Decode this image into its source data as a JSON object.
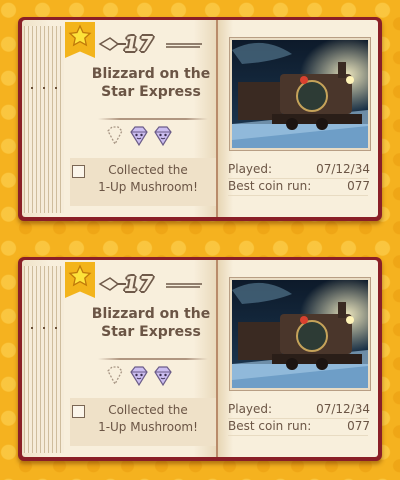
{
  "entries": [
    {
      "number": "17",
      "title_lines": [
        "Blizzard on the",
        "Star Express"
      ],
      "goal_lines": [
        "Collected the",
        "1-Up Mushroom!"
      ],
      "played_label": "Played:",
      "played_value": "07/12/34",
      "coin_label": "Best coin run:",
      "coin_value": "077",
      "tab_icon": "star-icon",
      "gems": [
        "empty-gem-icon",
        "purple-gem-icon",
        "purple-gem-icon"
      ],
      "goal_checked": false
    },
    {
      "number": "17",
      "title_lines": [
        "Blizzard on the",
        "Star Express"
      ],
      "goal_lines": [
        "Collected the",
        "1-Up Mushroom!"
      ],
      "played_label": "Played:",
      "played_value": "07/12/34",
      "coin_label": "Best coin run:",
      "coin_value": "077",
      "tab_icon": "star-icon",
      "gems": [
        "empty-gem-icon",
        "purple-gem-icon",
        "purple-gem-icon"
      ],
      "goal_checked": false
    }
  ],
  "colors": {
    "background": "#f5b21f",
    "book_cover": "#8a1f27",
    "page": "#f7ecd8",
    "text": "#6b5545",
    "gem_purple": "#b7a6dc"
  }
}
